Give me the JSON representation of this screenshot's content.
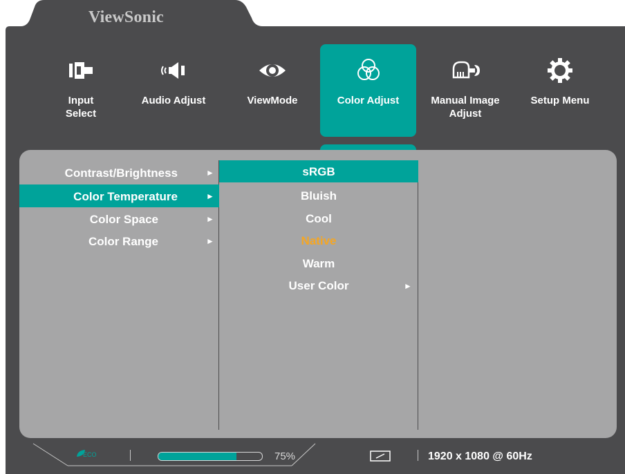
{
  "brand": "ViewSonic",
  "top_menu": [
    {
      "label": "Input\nSelect",
      "icon": "input-select-icon"
    },
    {
      "label": "Audio Adjust",
      "icon": "speaker-icon"
    },
    {
      "label": "ViewMode",
      "icon": "eye-icon"
    },
    {
      "label": "Color Adjust",
      "icon": "color-circles-icon",
      "active": true
    },
    {
      "label": "Manual Image\nAdjust",
      "icon": "hand-wrench-icon"
    },
    {
      "label": "Setup Menu",
      "icon": "gear-icon"
    }
  ],
  "submenu": [
    {
      "label": "Contrast/Brightness",
      "arrow": "►"
    },
    {
      "label": "Color Temperature",
      "arrow": "►",
      "selected": true
    },
    {
      "label": "Color Space",
      "arrow": "►"
    },
    {
      "label": "Color Range",
      "arrow": "►"
    }
  ],
  "options": [
    {
      "label": "sRGB",
      "highlighted": true
    },
    {
      "label": "Bluish"
    },
    {
      "label": "Cool"
    },
    {
      "label": "Native",
      "current": true
    },
    {
      "label": "Warm"
    },
    {
      "label": "User Color",
      "arrow": "►"
    }
  ],
  "status_bar": {
    "eco_label": "ECO",
    "volume_percent": 75,
    "volume_text": "75%",
    "aspect_icon": "aspect-ratio-icon",
    "resolution": "1920 x 1080 @ 60Hz"
  },
  "colors": {
    "accent": "#00a39a",
    "frame": "#4b4b4d",
    "panel": "#a6a6a7",
    "current_value": "#f5a623"
  }
}
